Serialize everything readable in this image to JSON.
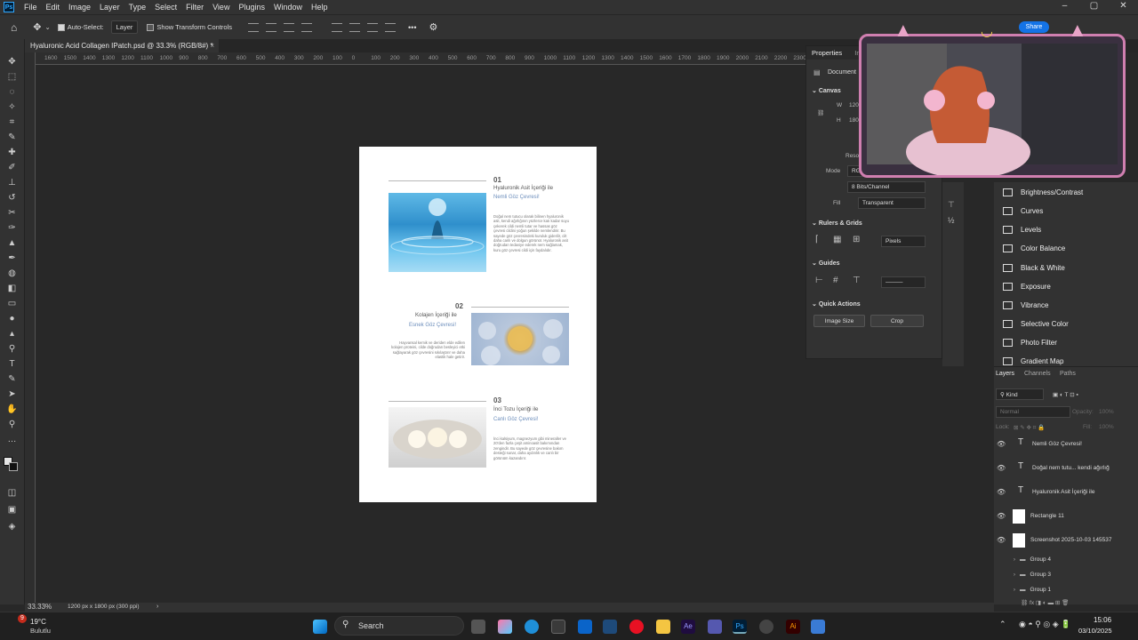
{
  "app": {
    "menu": [
      "File",
      "Edit",
      "Image",
      "Layer",
      "Type",
      "Select",
      "Filter",
      "View",
      "Plugins",
      "Window",
      "Help"
    ],
    "window_controls": [
      "–",
      "▢",
      "✕"
    ],
    "share_label": "Share"
  },
  "options": {
    "auto_select_label": "Auto-Select:",
    "auto_select_value": "Layer",
    "show_transform_label": "Show Transform Controls",
    "more": "•••"
  },
  "document": {
    "tab_title": "Hyaluronic Acid Collagen IPatch.psd @ 33.3% (RGB/8#) *",
    "tab_close": "×",
    "ruler_ticks": [
      "1600",
      "1500",
      "1400",
      "1300",
      "1200",
      "1100",
      "1000",
      "900",
      "800",
      "700",
      "600",
      "500",
      "400",
      "300",
      "200",
      "100",
      "0",
      "100",
      "200",
      "300",
      "400",
      "500",
      "600",
      "700",
      "800",
      "900",
      "1000",
      "1100",
      "1200",
      "1300",
      "1400",
      "1500",
      "1600",
      "1700",
      "1800",
      "1900",
      "2000",
      "2100",
      "2200",
      "2300"
    ],
    "sections": [
      {
        "num": "01",
        "title": "Hyaluronik Asit İçeriği ile",
        "subtitle": "Nemli Göz Çevresi!",
        "body": "Doğal nem tutucu olarak bilinen hyaluronik asit, kendi ağırlığının yüzlerce katı kadar suyu çekerek cildi nemli tutar ve hassas göz çevresi cildini yoğun şekilde nemlendirir. Bu sayede göz çevresindeki kuruluk giderilir, cilt daha canlı ve dolgun görünür. Hyaluronik asit doğrudan tedaviye ederek nem sağlamak, kuru göz çevresi cildi için faydalıdır."
      },
      {
        "num": "02",
        "title": "Kolajen İçeriği ile",
        "subtitle": "Esnek Göz Çevresi!",
        "body": "Hayvansal kemik ve deriden elde edilen kolajen proteini, cilde doğrudan besleyici etki sağlayarak göz çevresini sıkılaştırır ve daha elastik hale getirir."
      },
      {
        "num": "03",
        "title": "İnci Tozu İçeriği ile",
        "subtitle": "Canlı Göz Çevresi!",
        "body": "İnci kalsiyum, magnezyum gibi mineraller ve 20'den fazla çeşit aminoasit bakımından zengindir. Bu sayede göz çevresine bakım desteği sunar, daha aydınlık ve canlı bir görünüm kazandırır."
      }
    ]
  },
  "properties": {
    "tabs": [
      "Properties",
      "Info"
    ],
    "document_label": "Document",
    "canvas_label": "Canvas",
    "w_label": "W",
    "w_value": "120",
    "h_label": "H",
    "h_value": "180",
    "res_label": "Reso",
    "mode_label": "Mode",
    "mode_value": "RGB",
    "bits_value": "8 Bits/Channel",
    "fill_label": "Fill",
    "fill_value": "Transparent",
    "rulers_label": "Rulers & Grids",
    "units_value": "Pixels",
    "guides_label": "Guides",
    "quick_actions_label": "Quick Actions",
    "image_size_label": "Image Size",
    "crop_label": "Crop"
  },
  "adjustments": [
    "Brightness/Contrast",
    "Curves",
    "Levels",
    "Color Balance",
    "Black & White",
    "Exposure",
    "Vibrance",
    "Selective Color",
    "Photo Filter",
    "Gradient Map"
  ],
  "layers": {
    "tabs": [
      "Layers",
      "Channels",
      "Paths"
    ],
    "kind_label": "Kind",
    "blend_mode": "Normal",
    "opacity_label": "Opacity:",
    "opacity_value": "100%",
    "lock_label": "Lock:",
    "fill_label": "Fill:",
    "fill_value": "100%",
    "items": [
      {
        "name": "Nemli Göz Çevresi!",
        "type": "text"
      },
      {
        "name": "Doğal nem tutu... kendi ağırlığ",
        "type": "text"
      },
      {
        "name": "Hyaluronik Asit İçeriği ile",
        "type": "text"
      },
      {
        "name": "Rectangle 11",
        "type": "shape"
      },
      {
        "name": "Screenshot 2025-10-03 145537",
        "type": "image"
      }
    ],
    "groups": [
      "Group 4",
      "Group 3",
      "Group 1"
    ]
  },
  "status": {
    "zoom": "33.33%",
    "doc_size": "1200 px x 1800 px (300 ppi)"
  },
  "taskbar": {
    "weather_temp": "19°C",
    "weather_desc": "Bulutlu",
    "weather_badge": "9",
    "search_label": "Search",
    "time": "15:06",
    "date": "03/10/2025"
  }
}
